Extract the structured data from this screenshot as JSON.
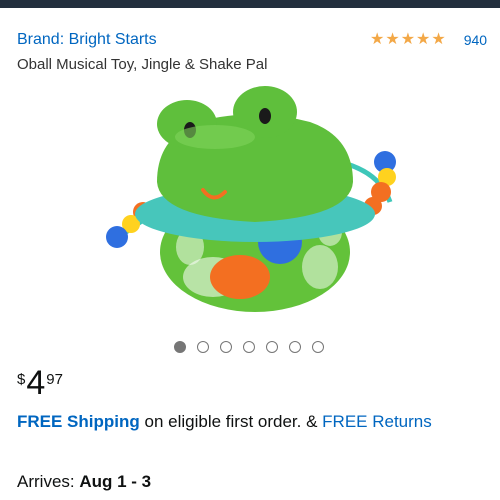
{
  "brand": {
    "label": "Brand: Bright Starts"
  },
  "rating": {
    "stars": 5,
    "count": "940",
    "star_color": "#f3a847"
  },
  "product": {
    "title": "Oball Musical Toy, Jingle & Shake Pal"
  },
  "carousel": {
    "total_images": 7,
    "active_index": 1
  },
  "price": {
    "symbol": "$",
    "whole": "4",
    "fraction": "97"
  },
  "shipping": {
    "free_shipping_label": "FREE Shipping",
    "middle_text": " on eligible first order. & ",
    "free_returns_label": "FREE Returns"
  },
  "delivery": {
    "label": "Arrives: ",
    "dates": "Aug 1 - 3"
  },
  "colors": {
    "link": "#0066c0",
    "header_bar": "#232f3e"
  }
}
